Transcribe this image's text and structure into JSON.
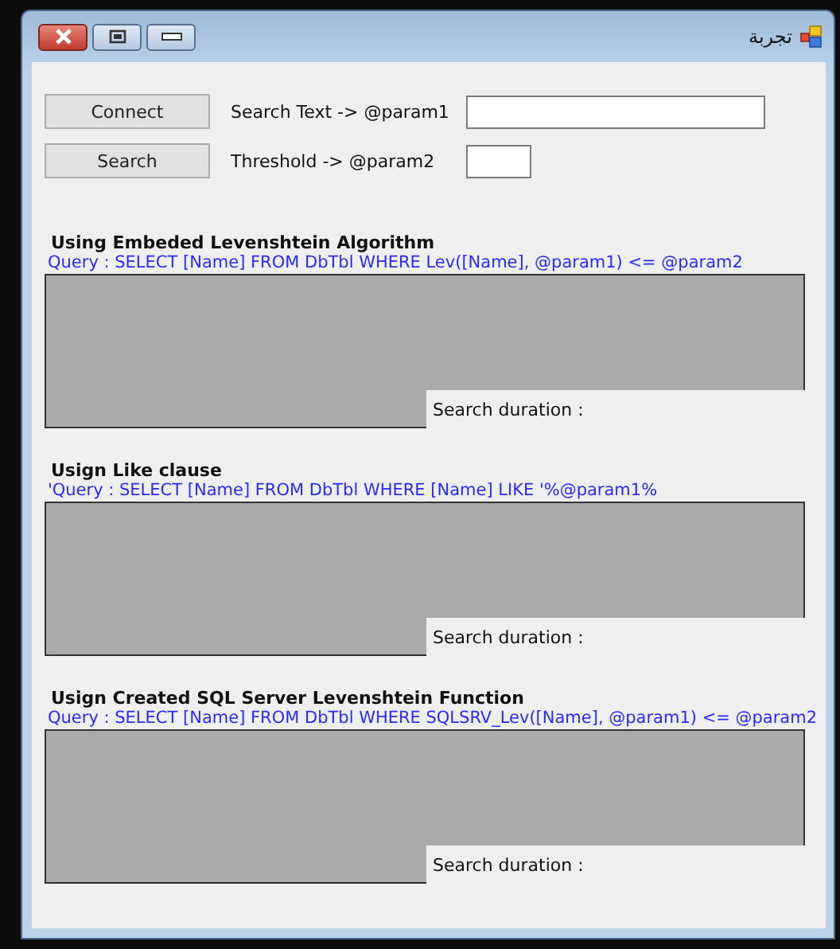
{
  "window": {
    "title": "تجربة"
  },
  "controls": [
    {
      "button": "Connect",
      "label": "Search Text -> @param1",
      "kind": "wide"
    },
    {
      "button": "Search",
      "label": "Threshold -> @param2",
      "kind": "narrow"
    }
  ],
  "sections": [
    {
      "heading": "Using Embeded Levenshtein Algorithm",
      "query": "Query : SELECT [Name] FROM DbTbl WHERE Lev([Name], @param1) <= @param2",
      "duration_label": "Search duration :"
    },
    {
      "heading": "Usign Like clause",
      "query": "'Query : SELECT [Name] FROM DbTbl WHERE [Name] LIKE '%@param1%",
      "duration_label": "Search duration :"
    },
    {
      "heading": "Usign Created SQL Server Levenshtein Function",
      "query": "Query : SELECT [Name] FROM DbTbl WHERE SQLSRV_Lev([Name], @param1) <= @param2",
      "duration_label": "Search duration :"
    }
  ]
}
